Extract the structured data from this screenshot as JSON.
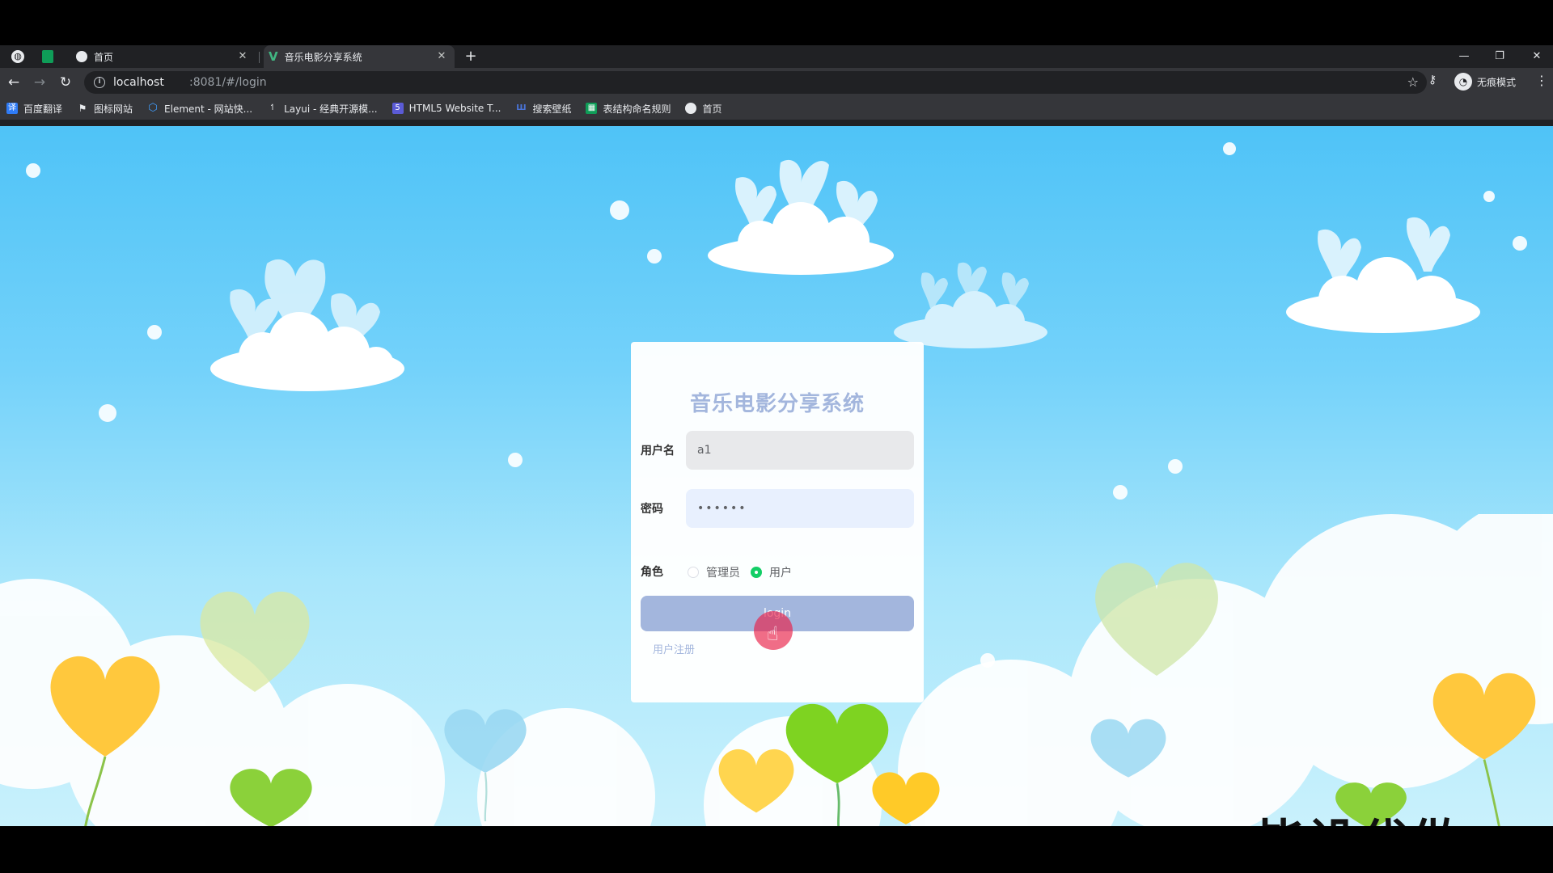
{
  "browser": {
    "tabs": [
      {
        "title": "首页",
        "icon": "globe-icon"
      },
      {
        "title": "音乐电影分享系统",
        "icon": "vue-icon"
      }
    ],
    "new_tab_symbol": "+",
    "url_host": "localhost",
    "url_rest": ":8081/#/login",
    "incognito_label": "无痕模式",
    "bookmarks": [
      {
        "label": "百度翻译",
        "icon": "translate-icon",
        "color": "#2f7bf5"
      },
      {
        "label": "图标网站",
        "icon": "flag-icon",
        "color": "#e8eaed"
      },
      {
        "label": "Element - 网站快...",
        "icon": "element-icon",
        "color": "#409eff"
      },
      {
        "label": "Layui - 经典开源模...",
        "icon": "layui-icon",
        "color": "#e8eaed"
      },
      {
        "label": "HTML5 Website T...",
        "icon": "html5-icon",
        "color": "#5b5bd6"
      },
      {
        "label": "搜索壁纸",
        "icon": "wallpaper-icon",
        "color": "#4a74d8"
      },
      {
        "label": "表结构命名规则",
        "icon": "sheet-icon",
        "color": "#0f9d58"
      },
      {
        "label": "首页",
        "icon": "globe-icon",
        "color": "#e8eaed"
      }
    ]
  },
  "login": {
    "title": "音乐电影分享系统",
    "username_label": "用户名",
    "username_value": "a1",
    "password_label": "密码",
    "password_value": "••••••",
    "role_label": "角色",
    "roles": [
      {
        "label": "管理员",
        "checked": false
      },
      {
        "label": "用户",
        "checked": true
      }
    ],
    "login_button": "login",
    "register_link": "用户注册"
  },
  "overlay_text": "毕设代做",
  "colors": {
    "accent": "#a3b6dd",
    "radio_checked": "#13ce66",
    "sky_top": "#4fc3f7",
    "sky_bottom": "#c9f1fc"
  }
}
